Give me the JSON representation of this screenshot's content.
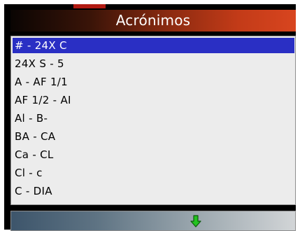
{
  "header": {
    "title": "Acrónimos"
  },
  "list": {
    "selected_index": 0,
    "items": [
      "# - 24X C",
      "24X S - 5",
      "A - AF 1/1",
      "AF 1/2 - AI",
      "Al - B-",
      "BA - CA",
      "Ca - CL",
      "Cl - c",
      "C - DIA"
    ]
  },
  "footer": {
    "scroll_icon": "down-arrow-icon"
  },
  "colors": {
    "selection": "#2a2fc4",
    "header_gradient_end": "#d8451f",
    "arrow": "#22c31f"
  }
}
